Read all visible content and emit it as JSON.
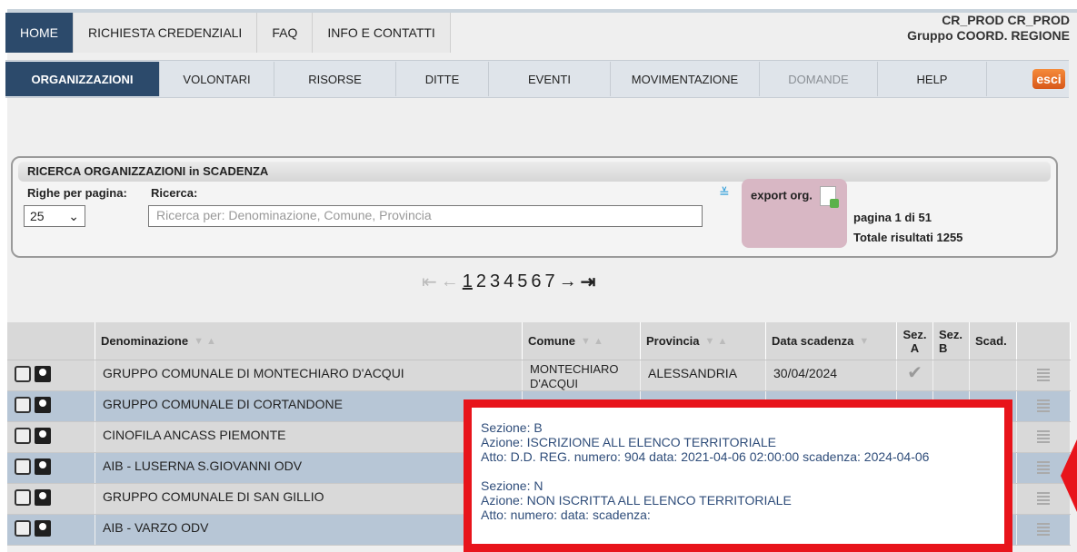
{
  "top_nav": {
    "tabs": [
      {
        "label": "HOME",
        "active": true
      },
      {
        "label": "RICHIESTA CREDENZIALI"
      },
      {
        "label": "FAQ"
      },
      {
        "label": "INFO E CONTATTI"
      }
    ],
    "user_line1": "CR_PROD CR_PROD",
    "user_line2": "Gruppo COORD. REGIONE"
  },
  "sub_nav": {
    "tabs": [
      {
        "label": "ORGANIZZAZIONI",
        "active": true
      },
      {
        "label": "VOLONTARI"
      },
      {
        "label": "RISORSE"
      },
      {
        "label": "DITTE"
      },
      {
        "label": "EVENTI"
      },
      {
        "label": "MOVIMENTAZIONE"
      },
      {
        "label": "DOMANDE",
        "disabled": true
      },
      {
        "label": "HELP"
      }
    ],
    "logout_label": "esci"
  },
  "search_panel": {
    "title": "RICERCA ORGANIZZAZIONI in SCADENZA",
    "rows_per_page_label": "Righe per pagina:",
    "rows_per_page_value": "25",
    "search_label": "Ricerca:",
    "search_placeholder": "Ricerca per: Denominazione, Comune, Provincia",
    "export_label": "export org.",
    "page_info": "pagina 1 di 51",
    "total_results": "Totale risultati 1255"
  },
  "pagination": {
    "first": "⇤",
    "prev": "←",
    "pages": [
      "1",
      "2",
      "3",
      "4",
      "5",
      "6",
      "7"
    ],
    "next": "→",
    "last": "⇥"
  },
  "table": {
    "headers": {
      "denominazione": "Denominazione",
      "comune": "Comune",
      "provincia": "Provincia",
      "data_scadenza": "Data scadenza",
      "sez_a": "Sez. A",
      "sez_b": "Sez. B",
      "scad": "Scad."
    },
    "rows": [
      {
        "denominazione": "GRUPPO COMUNALE DI MONTECHIARO D'ACQUI",
        "comune": "MONTECHIARO D'ACQUI",
        "provincia": "ALESSANDRIA",
        "data": "30/04/2024",
        "sez_a_checked": true
      },
      {
        "denominazione": "GRUPPO COMUNALE DI CORTANDONE",
        "comune": "",
        "provincia": "",
        "data": ""
      },
      {
        "denominazione": "CINOFILA ANCASS PIEMONTE",
        "comune": "",
        "provincia": "",
        "data": ""
      },
      {
        "denominazione": "AIB - LUSERNA S.GIOVANNI ODV",
        "comune": "",
        "provincia": "",
        "data": ""
      },
      {
        "denominazione": "GRUPPO COMUNALE DI SAN GILLIO",
        "comune": "",
        "provincia": "",
        "data": ""
      },
      {
        "denominazione": "AIB - VARZO ODV",
        "comune": "",
        "provincia": "",
        "data": ""
      }
    ]
  },
  "tooltip": {
    "block1": {
      "sezione": "Sezione: B",
      "azione": "Azione: ISCRIZIONE ALL ELENCO TERRITORIALE",
      "atto": "Atto: D.D. REG. numero: 904 data: 2021-04-06 02:00:00 scadenza: 2024-04-06"
    },
    "block2": {
      "sezione": "Sezione: N",
      "azione": "Azione: NON ISCRITTA ALL ELENCO TERRITORIALE",
      "atto": "Atto: numero: data: scadenza:"
    }
  },
  "colors": {
    "nav_active": "#2c4a6b",
    "row_even": "#b7c6d6",
    "highlight": "#e8141b",
    "export_bg": "#d8b7c4"
  }
}
